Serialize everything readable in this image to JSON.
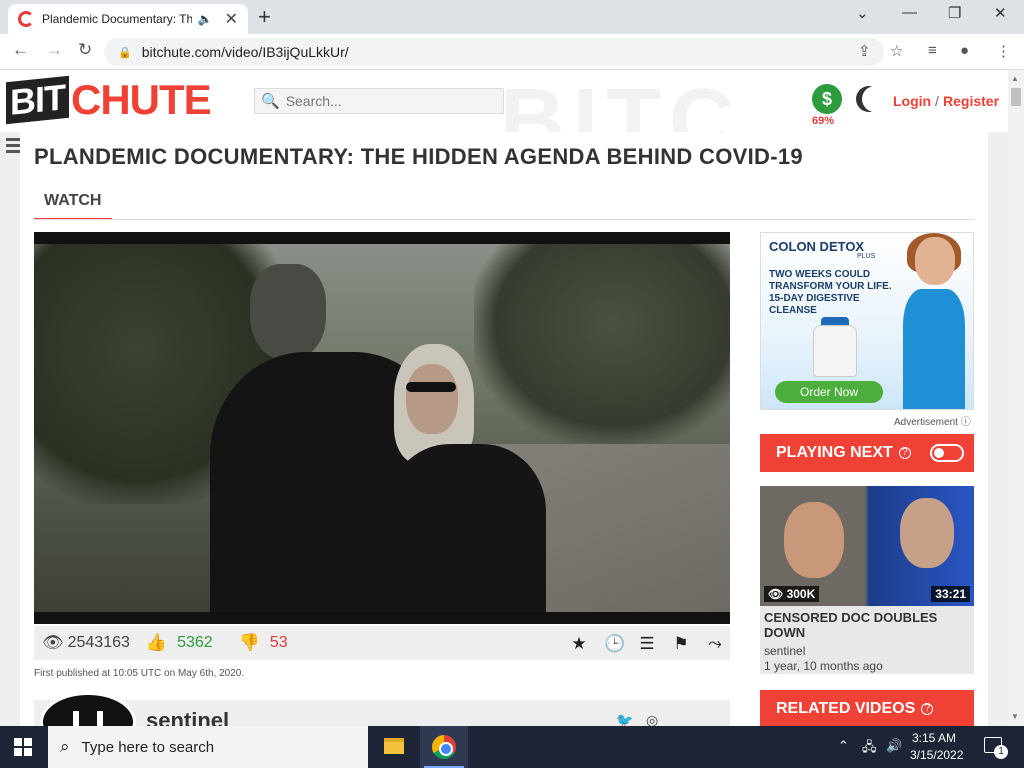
{
  "browser": {
    "tab_title": "Plandemic Documentary: Th",
    "audio_icon": "speaker-icon",
    "url": "bitchute.com/video/IB3ijQuLkkUr/"
  },
  "site": {
    "logo_bit": "BIT",
    "logo_chute": "CHUTE",
    "search_placeholder": "Search...",
    "money_pct": "69%",
    "login": "Login",
    "slash": "/",
    "register": "Register"
  },
  "video": {
    "title": "PLANDEMIC DOCUMENTARY: THE HIDDEN AGENDA BEHIND COVID-19",
    "watch_tab": "WATCH",
    "views": "2543163",
    "likes": "5362",
    "dislikes": "53",
    "first_published": "First published at 10:05 UTC on May 6th, 2020."
  },
  "channel": {
    "name": "sentinel"
  },
  "sidebar": {
    "ad": {
      "brand": "COLON DETOX",
      "plus": "PLUS",
      "text": "TWO WEEKS COULD TRANSFORM YOUR LIFE. 15-DAY DIGESTIVE CLEANSE",
      "button": "Order Now",
      "label": "Advertisement"
    },
    "playing_next": "PLAYING NEXT",
    "next_video": {
      "views": "300K",
      "duration": "33:21",
      "title": "CENSORED DOC DOUBLES DOWN",
      "channel": "sentinel",
      "age": "1 year, 10 months ago"
    },
    "related_videos": "RELATED VIDEOS"
  },
  "taskbar": {
    "search_text": "Type here to search",
    "time": "3:15 AM",
    "date": "3/15/2022",
    "notifications": "1"
  },
  "colors": {
    "accent": "#ef4136",
    "like": "#2e9b3e",
    "dislike": "#e53b3b"
  }
}
